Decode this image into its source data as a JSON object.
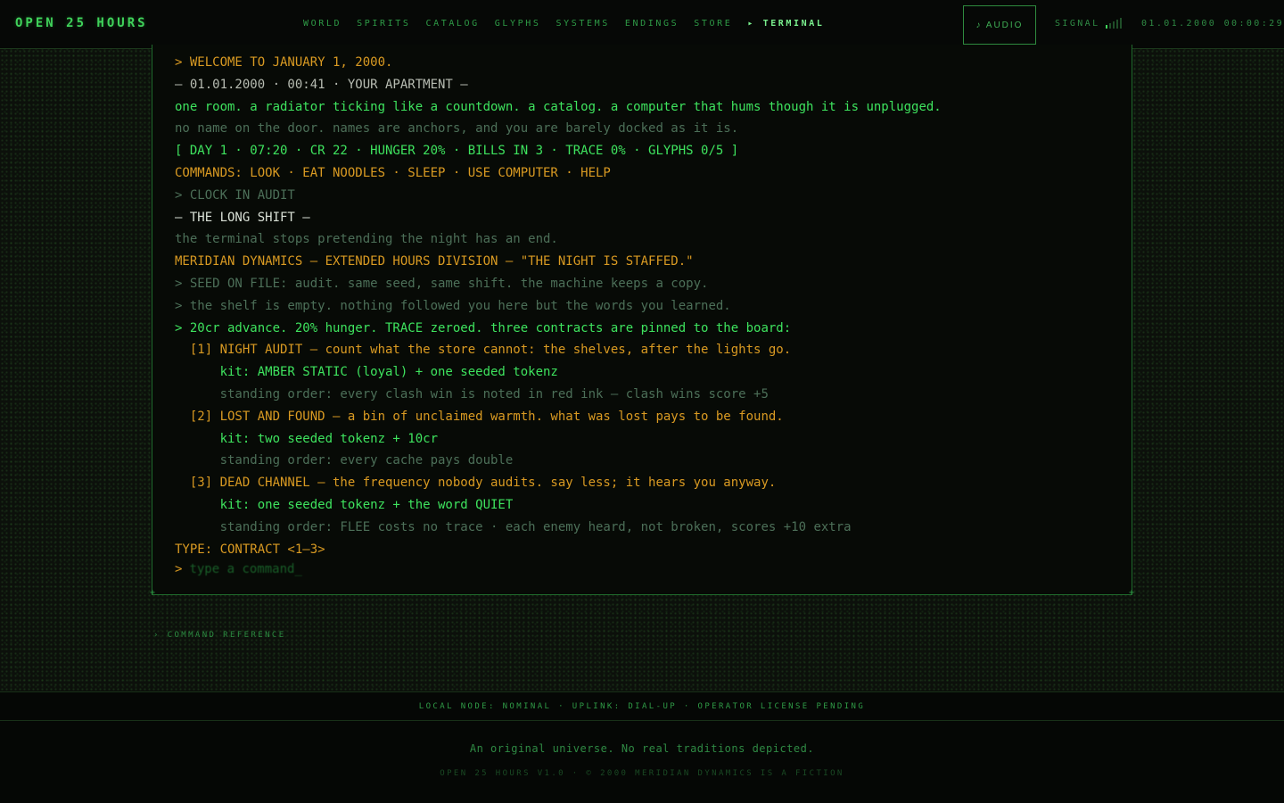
{
  "header": {
    "brand": "OPEN 25 HOURS",
    "nav": [
      "WORLD",
      "SPIRITS",
      "CATALOG",
      "GLYPHS",
      "SYSTEMS",
      "ENDINGS",
      "STORE",
      "▸ TERMINAL"
    ],
    "active_nav": "▸ TERMINAL",
    "audio_label": "♪ AUDIO",
    "signal_label": "SIGNAL",
    "signal_level": 0.2,
    "clock": "01.01.2000 00:00:29"
  },
  "terminal": {
    "lines": [
      {
        "text": "> WELCOME TO JANUARY 1, 2000.",
        "tone": "amber"
      },
      {
        "text": "— 01.01.2000 · 00:41 · YOUR APARTMENT —",
        "tone": "gray"
      },
      {
        "text": "one room. a radiator ticking like a countdown. a catalog. a computer that hums though it is unplugged.",
        "tone": "green"
      },
      {
        "text": "no name on the door. names are anchors, and you are barely docked as it is.",
        "tone": "dim"
      },
      {
        "text": "[ DAY 1 · 07:20 · CR 22 · HUNGER 20% · BILLS IN 3 · TRACE 0% · GLYPHS 0/5 ]",
        "tone": "green"
      },
      {
        "text": "COMMANDS: LOOK · EAT NOODLES · SLEEP · USE COMPUTER · HELP",
        "tone": "amber"
      },
      {
        "text": "> CLOCK IN AUDIT",
        "tone": "dim"
      },
      {
        "text": "— THE LONG SHIFT —",
        "tone": "white"
      },
      {
        "text": "the terminal stops pretending the night has an end.",
        "tone": "dim"
      },
      {
        "text": "MERIDIAN DYNAMICS — EXTENDED HOURS DIVISION — \"THE NIGHT IS STAFFED.\"",
        "tone": "amber"
      },
      {
        "text": "> SEED ON FILE: audit. same seed, same shift. the machine keeps a copy.",
        "tone": "dim"
      },
      {
        "text": "> the shelf is empty. nothing followed you here but the words you learned.",
        "tone": "dim"
      },
      {
        "text": "> 20cr advance. 20% hunger. TRACE zeroed. three contracts are pinned to the board:",
        "tone": "green"
      },
      {
        "text": "  [1] NIGHT AUDIT — count what the store cannot: the shelves, after the lights go.",
        "tone": "amber"
      },
      {
        "text": "      kit: AMBER STATIC (loyal) + one seeded tokenz",
        "tone": "green"
      },
      {
        "text": "      standing order: every clash win is noted in red ink — clash wins score +5",
        "tone": "dim"
      },
      {
        "text": "  [2] LOST AND FOUND — a bin of unclaimed warmth. what was lost pays to be found.",
        "tone": "amber"
      },
      {
        "text": "      kit: two seeded tokenz + 10cr",
        "tone": "green"
      },
      {
        "text": "      standing order: every cache pays double",
        "tone": "dim"
      },
      {
        "text": "  [3] DEAD CHANNEL — the frequency nobody audits. say less; it hears you anyway.",
        "tone": "amber"
      },
      {
        "text": "      kit: one seeded tokenz + the word QUIET",
        "tone": "green"
      },
      {
        "text": "      standing order: FLEE costs no trace · each enemy heard, not broken, scores +10 extra",
        "tone": "dim"
      },
      {
        "text": "TYPE: CONTRACT <1–3>",
        "tone": "amber"
      }
    ],
    "prompt_caret": ">",
    "input_placeholder": "type a command_",
    "input_value": ""
  },
  "command_reference": "› COMMAND REFERENCE",
  "status_strip": "LOCAL NODE: NOMINAL · UPLINK: DIAL-UP · OPERATOR LICENSE PENDING",
  "footer": {
    "note": "An original universe. No real traditions depicted.",
    "copy": "OPEN 25 HOURS V1.0 · © 2000 MERIDIAN DYNAMICS IS A FICTION"
  },
  "colors": {
    "amber": "#d99a22",
    "green": "#3ee35e",
    "dim": "#4c6f58",
    "white": "#d9e0d6",
    "frame": "#1f6a2c"
  }
}
